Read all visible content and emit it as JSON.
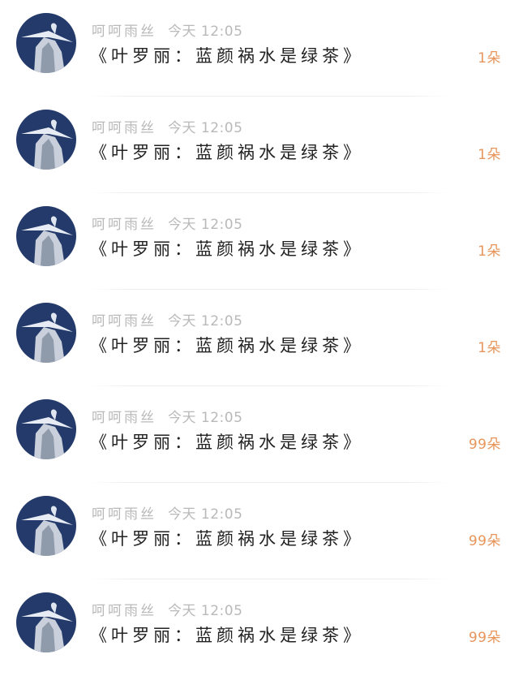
{
  "items": [
    {
      "user": "呵呵雨丝",
      "time": "今天 12:05",
      "title": "《叶罗丽：蓝颜祸水是绿茶》",
      "count": "1朵"
    },
    {
      "user": "呵呵雨丝",
      "time": "今天 12:05",
      "title": "《叶罗丽：蓝颜祸水是绿茶》",
      "count": "1朵"
    },
    {
      "user": "呵呵雨丝",
      "time": "今天 12:05",
      "title": "《叶罗丽：蓝颜祸水是绿茶》",
      "count": "1朵"
    },
    {
      "user": "呵呵雨丝",
      "time": "今天 12:05",
      "title": "《叶罗丽：蓝颜祸水是绿茶》",
      "count": "1朵"
    },
    {
      "user": "呵呵雨丝",
      "time": "今天 12:05",
      "title": "《叶罗丽：蓝颜祸水是绿茶》",
      "count": "99朵"
    },
    {
      "user": "呵呵雨丝",
      "time": "今天 12:05",
      "title": "《叶罗丽：蓝颜祸水是绿茶》",
      "count": "99朵"
    },
    {
      "user": "呵呵雨丝",
      "time": "今天 12:05",
      "title": "《叶罗丽：蓝颜祸水是绿茶》",
      "count": "99朵"
    }
  ],
  "colors": {
    "username": "#b9b9b9",
    "title": "#222222",
    "count": "#e7955a",
    "avatar_background": "#233a6b"
  }
}
